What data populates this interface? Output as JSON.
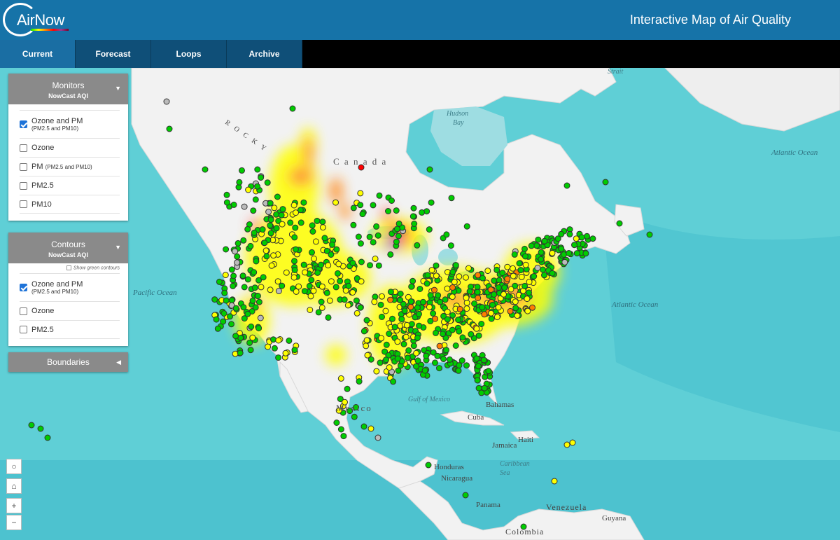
{
  "header": {
    "logo_text": "AirNow",
    "title": "Interactive Map of Air Quality"
  },
  "nav": {
    "tabs": [
      "Current",
      "Forecast",
      "Loops",
      "Archive"
    ],
    "active": "Current"
  },
  "monitors_panel": {
    "title": "Monitors",
    "subtitle": "NowCast AQI",
    "options": [
      {
        "label": "Ozone and PM",
        "sub": "(PM2.5 and PM10)",
        "checked": true
      },
      {
        "label": "Ozone",
        "checked": false
      },
      {
        "label": "PM",
        "inline_sub": "(PM2.5 and PM10)",
        "checked": false
      },
      {
        "label": "PM2.5",
        "checked": false
      },
      {
        "label": "PM10",
        "checked": false
      }
    ]
  },
  "contours_panel": {
    "title": "Contours",
    "subtitle": "NowCast AQI",
    "show_green": "Show green contours",
    "options": [
      {
        "label": "Ozone and PM",
        "sub": "(PM2.5 and PM10)",
        "checked": true
      },
      {
        "label": "Ozone",
        "checked": false
      },
      {
        "label": "PM2.5",
        "checked": false
      }
    ]
  },
  "boundaries": {
    "title": "Boundaries"
  },
  "map_controls": {
    "locate": "○",
    "home": "⌂",
    "zoom_in": "+",
    "zoom_out": "−"
  },
  "map_labels": {
    "pacific": "Pacific Ocean",
    "atlantic_ne": "Atlantic Ocean",
    "atlantic": "Atlantic Ocean",
    "hudson": "Hudson",
    "bay": "Bay",
    "strait": "Strait",
    "canada": "C a n a d a",
    "rocky": "R O C K Y",
    "mexico": "Mexico",
    "gulf": "Gulf of Mexico",
    "bahamas": "Bahamas",
    "cuba": "Cuba",
    "haiti": "Haiti",
    "jamaica": "Jamaica",
    "caribbean": "Caribbean",
    "sea": "Sea",
    "honduras": "Honduras",
    "nicaragua": "Nicaragua",
    "panama": "Panama",
    "venezuela": "Venezuela",
    "guyana": "Guyana",
    "colombia": "Colombia"
  },
  "colors": {
    "good": "#00cc00",
    "moderate": "#ffff00",
    "usg": "#ff7e00",
    "unhealthy": "#ff0000",
    "very_unhealthy": "#8f3f97",
    "no_data": "#bbbbbb",
    "land": "#f2f2f2",
    "ocean": "#5fcfd6",
    "header": "#1673a8",
    "tab": "#0f4f78"
  }
}
